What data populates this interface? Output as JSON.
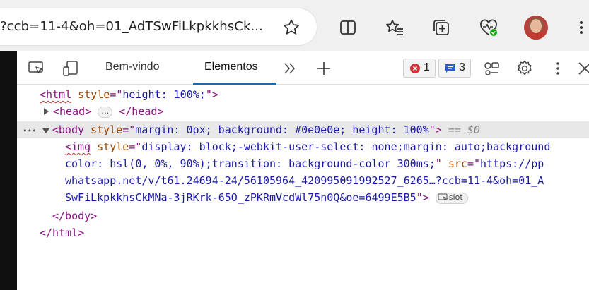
{
  "browser": {
    "address_text": "?ccb=11-4&oh=01_AdTSwFiLkpkkhsCk...",
    "icons": [
      "star-icon",
      "split-screen-icon",
      "favorites-icon",
      "collections-icon",
      "browser-essentials-icon",
      "profile-avatar",
      "more-menu-icon"
    ]
  },
  "devtools": {
    "tabs": {
      "welcome": "Bem-vindo",
      "elements": "Elementos"
    },
    "error_count": "1",
    "message_count": "3",
    "colors": {
      "accent": "#0f6cbd",
      "error": "#d13438",
      "message": "#2260d6"
    }
  },
  "dom": {
    "html_open": {
      "tag": "<html",
      "attr": " style",
      "eq": "=\"",
      "val": "height: 100%;",
      "close": "\">"
    },
    "head": {
      "open": "<head>",
      "ellipsis": "…",
      "close": "</head>"
    },
    "body_open": {
      "tag": "<body",
      "attr": " style",
      "eq": "=\"",
      "val": "margin: 0px; background: #0e0e0e; height: 100%",
      "close": "\">",
      "eqvar": " == $0",
      "dots": "•••"
    },
    "img_line1": {
      "tag": "<img",
      "attr": " style",
      "eq": "=\"",
      "val": "display: block;-webkit-user-select: none;margin: auto;background"
    },
    "img_line2": {
      "val": "color: hsl(0, 0%, 90%);transition: background-color 300ms;",
      "q": "\"",
      "attr": " src",
      "eq": "=\"",
      "val2": "https://pp"
    },
    "img_line3": {
      "val": "whatsapp.net/v/t61.24694-24/56105964_420995091992527_6265…?ccb=11-4&oh=01_A"
    },
    "img_line4": {
      "val": "SwFiLkpkkhsCkMNa-3jRKrk-65O_zPKRmVcdWl75n0Q&oe=6499E5B5",
      "close": "\">",
      "slot": "slot"
    },
    "body_close": "</body>",
    "html_close": "</html>"
  }
}
